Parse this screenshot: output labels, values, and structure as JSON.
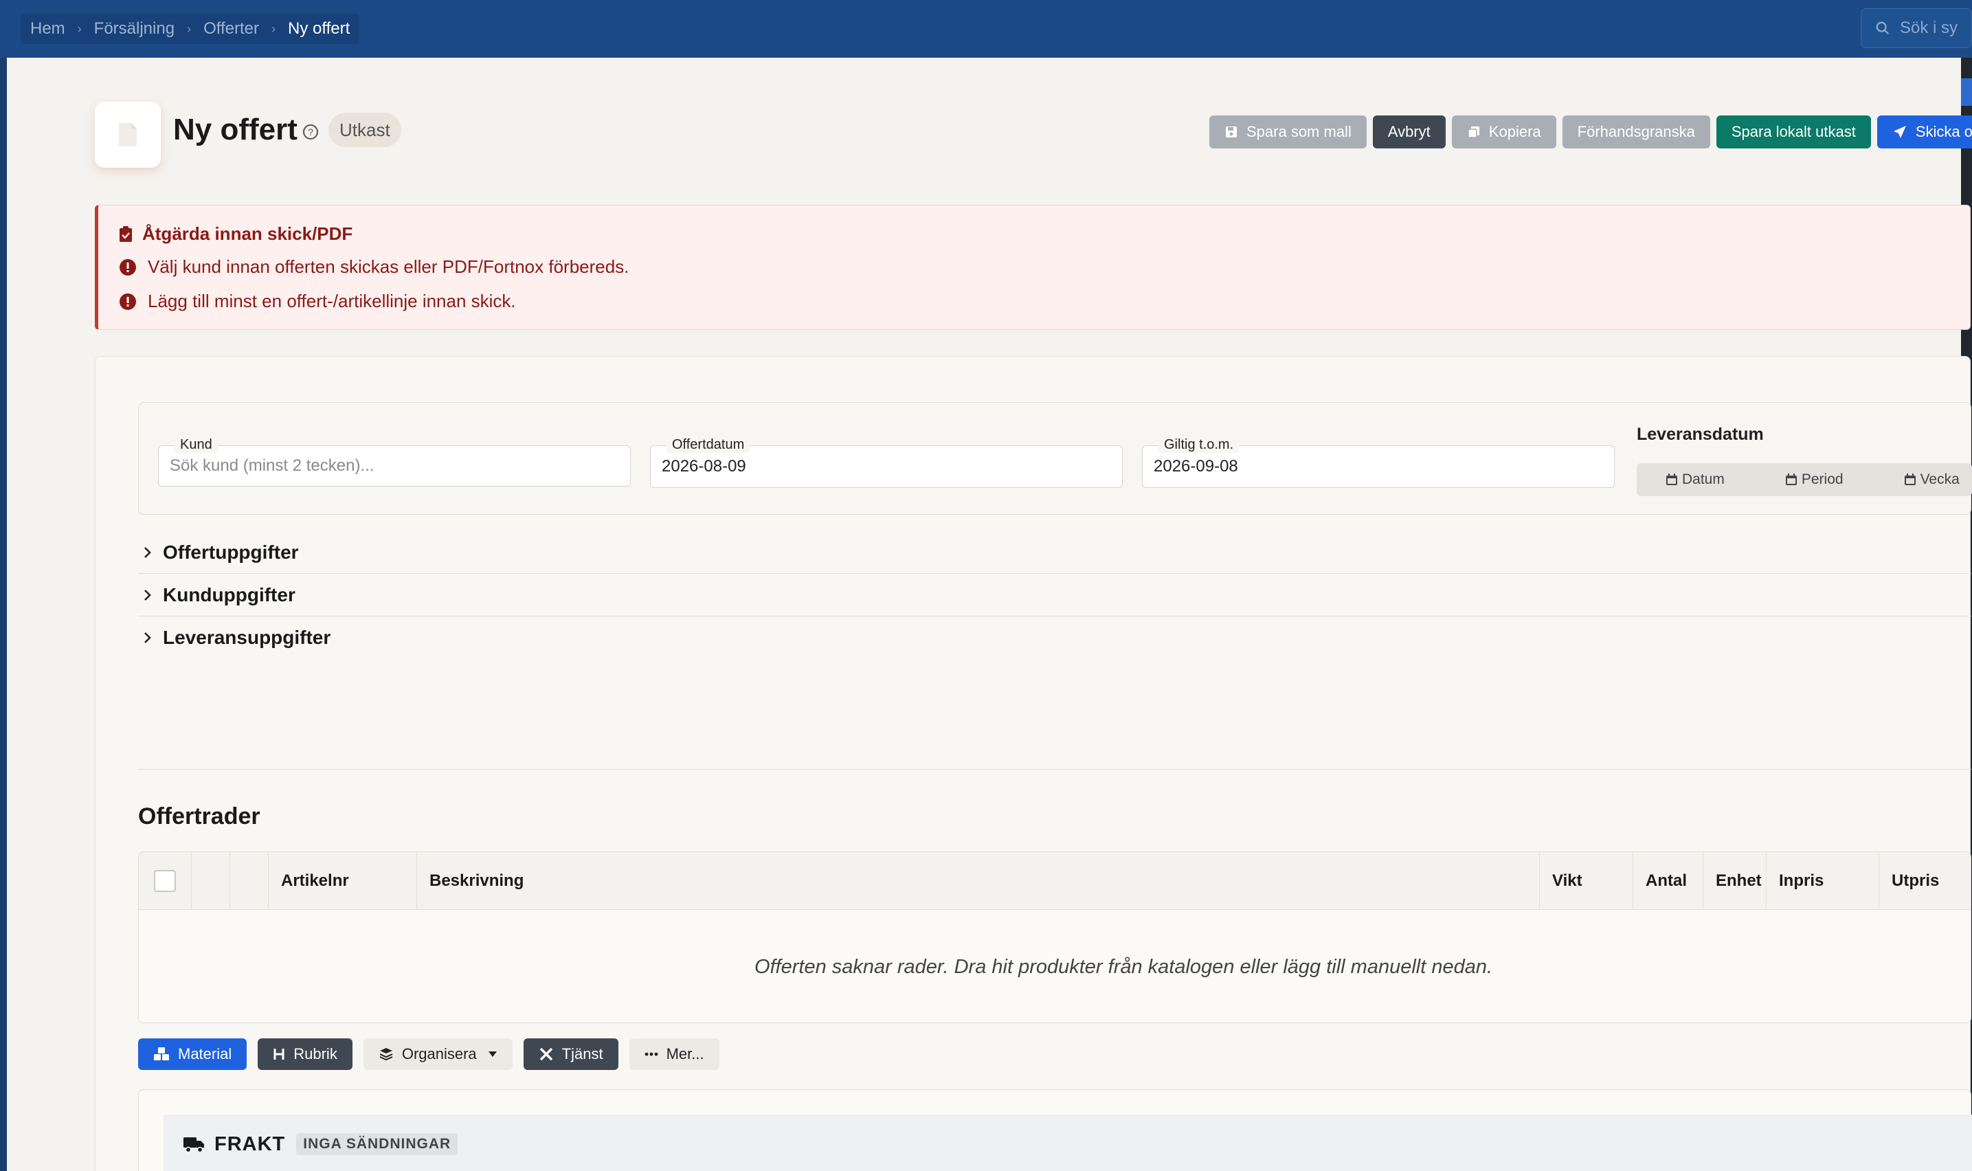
{
  "topbar": {
    "breadcrumbs": [
      "Hem",
      "Försäljning",
      "Offerter",
      "Ny offert"
    ],
    "search_placeholder": "Sök i sy"
  },
  "header": {
    "title": "Ny offert",
    "status": "Utkast",
    "buttons": {
      "save_template": "Spara som mall",
      "cancel": "Avbryt",
      "copy": "Kopiera",
      "preview": "Förhandsgranska",
      "save_local": "Spara lokalt utkast",
      "send": "Skicka offe"
    }
  },
  "alert": {
    "title": "Åtgärda innan skick/PDF",
    "messages": [
      "Välj kund innan offerten skickas eller PDF/Fortnox förbereds.",
      "Lägg till minst en offert-/artikellinje innan skick."
    ]
  },
  "form": {
    "customer_label": "Kund",
    "customer_placeholder": "Sök kund (minst 2 tecken)...",
    "quote_date_label": "Offertdatum",
    "quote_date": "2026-08-09",
    "valid_until_label": "Giltig t.o.m.",
    "valid_until": "2026-09-08",
    "delivery_date_label": "Leveransdatum",
    "delivery_modes": [
      "Datum",
      "Period",
      "Vecka"
    ]
  },
  "sections": [
    "Offertuppgifter",
    "Kunduppgifter",
    "Leveransuppgifter"
  ],
  "rows": {
    "title": "Offertrader",
    "columns": [
      "Artikelnr",
      "Beskrivning",
      "Vikt",
      "Antal",
      "Enhet",
      "Inpris",
      "Utpris"
    ],
    "empty_text": "Offerten saknar rader. Dra hit produkter från katalogen eller lägg till manuellt nedan.",
    "actions": {
      "material": "Material",
      "rubrik": "Rubrik",
      "organisera": "Organisera",
      "tjanst": "Tjänst",
      "mer": "Mer..."
    }
  },
  "frakt": {
    "title": "FRAKT",
    "badge": "INGA SÄNDNINGAR"
  },
  "colors": {
    "topbar": "#1b4a86",
    "primary": "#1f62e0",
    "teal": "#0b7a68",
    "danger": "#8a1a16"
  }
}
